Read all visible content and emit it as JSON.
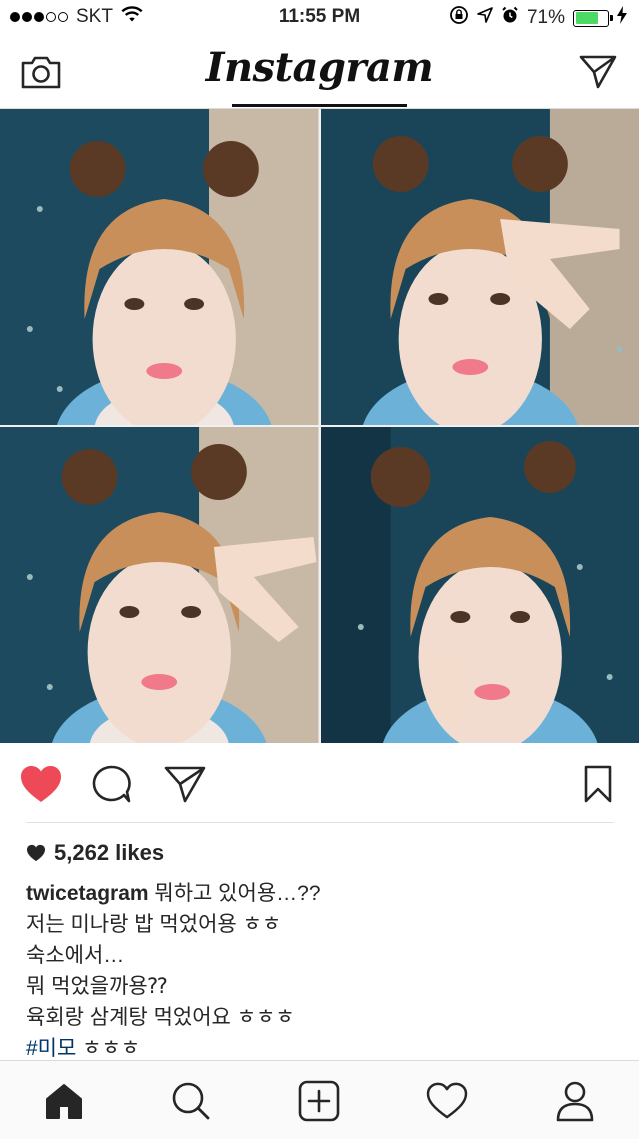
{
  "status_bar": {
    "carrier": "SKT",
    "time": "11:55 PM",
    "battery_percent": "71%",
    "battery_level": 0.71,
    "signal_bars_filled": 3,
    "signal_bars_total": 5
  },
  "header": {
    "logo": "Instagram",
    "left_icon": "camera-icon",
    "right_icon": "direct-message-icon"
  },
  "post": {
    "liked": true,
    "like_color": "#ed4956",
    "likes_text": "5,262 likes",
    "username": "twicetagram",
    "caption_lines": [
      " 뭐하고 있어용…??",
      "저는 미나랑 밥 먹었어용 ㅎㅎ",
      "숙소에서…",
      "뭐 먹었을까용⁇",
      "육회랑 삼계탕 먹었어요 ㅎㅎㅎ"
    ],
    "hashtag": "#미모",
    "hashtag_suffix": " ㅎㅎㅎ"
  },
  "tab_bar": {
    "tabs": [
      "home-icon",
      "search-icon",
      "new-post-icon",
      "activity-icon",
      "profile-icon"
    ],
    "active": "home-icon"
  },
  "colors": {
    "hashtag": "#003569",
    "battery": "#4cd964",
    "text": "#262626"
  }
}
